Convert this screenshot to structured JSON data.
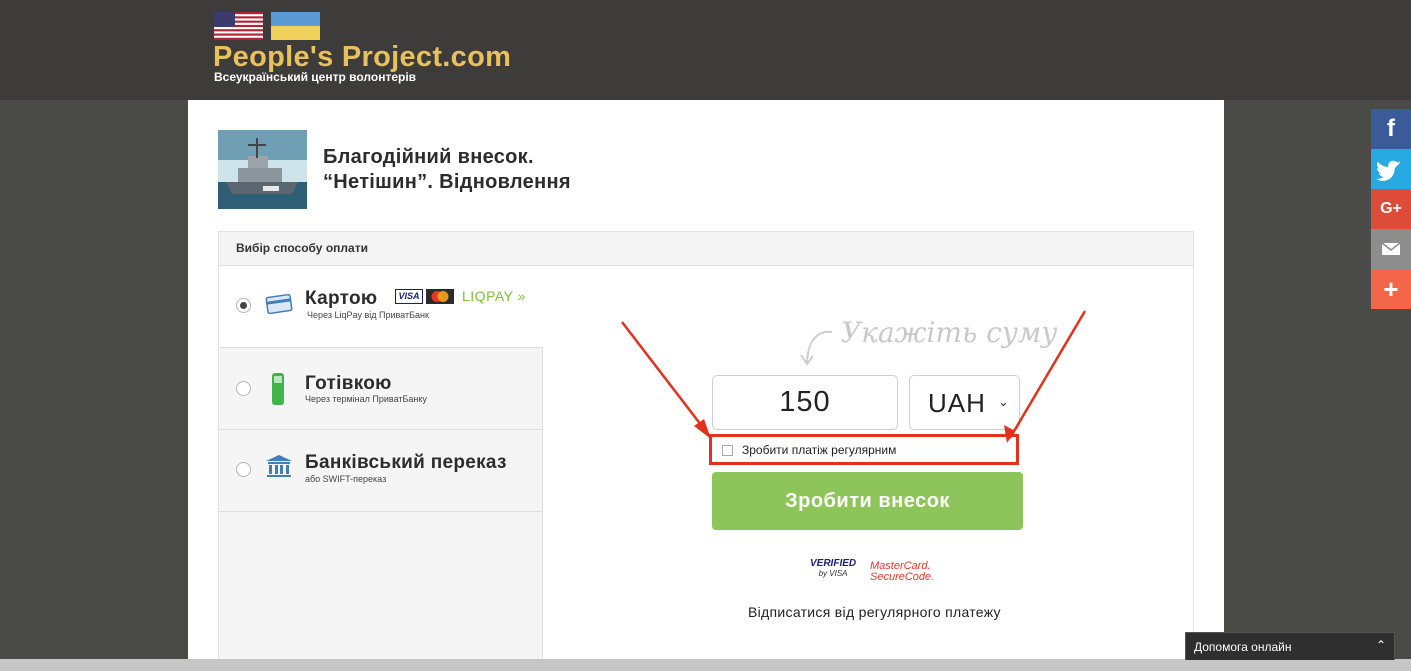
{
  "header": {
    "site_title": "People's Project.com",
    "site_subtitle": "Всеукраїнський центр волонтерів"
  },
  "project": {
    "title_line1": "Благодійний внесок.",
    "title_line2": "“Нетішин”. Відновлення"
  },
  "payment": {
    "heading": "Вибір способу оплати",
    "methods": [
      {
        "label": "Картою",
        "sub": "Через LiqPay від ПриватБанк",
        "selected": true
      },
      {
        "label": "Готівкою",
        "sub": "Через термінал ПриватБанку",
        "selected": false
      },
      {
        "label": "Банківський переказ",
        "sub": "або SWIFT-переказ",
        "selected": false
      }
    ],
    "card_brands": {
      "visa": "VISA",
      "liqpay": "LIQPAY"
    }
  },
  "form": {
    "hint": "Укажіть суму",
    "amount": "150",
    "currency": "UAH",
    "recurring_label": "Зробити платіж регулярним",
    "recurring_checked": false,
    "submit_label": "Зробити внесок",
    "verified_line1": "VERIFIED",
    "verified_line2": "by VISA",
    "securecode_line1": "MasterCard.",
    "securecode_line2": "SecureCode.",
    "unsubscribe": "Відписатися від регулярного платежу"
  },
  "social": [
    "facebook-icon",
    "twitter-icon",
    "google-plus-icon",
    "email-icon",
    "plus-icon"
  ],
  "chat": {
    "label": "Допомога онлайн"
  },
  "colors": {
    "accent_green": "#8dc55a",
    "highlight_red": "#e2311d",
    "logo_yellow": "#e8c15c",
    "facebook": "#3a5a98",
    "twitter": "#27a9e1",
    "google_plus": "#dd4c39",
    "email": "#8d8d8d",
    "plus": "#f4664a"
  }
}
